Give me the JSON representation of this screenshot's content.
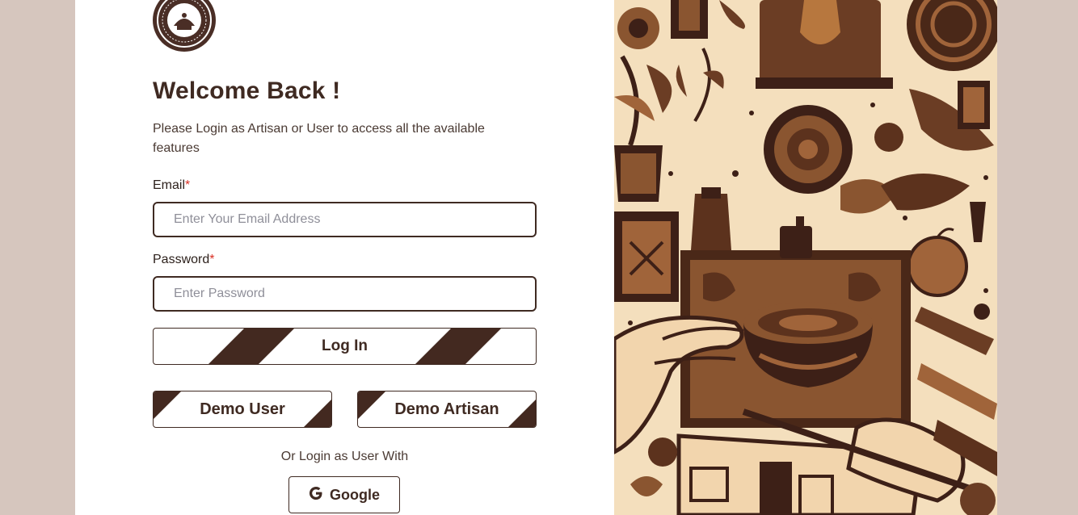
{
  "heading": {
    "title": "Welcome Back !",
    "subtitle": "Please Login as Artisan or User to access all the available features"
  },
  "form": {
    "email": {
      "label": "Email",
      "required_mark": "*",
      "placeholder": "Enter Your Email Address",
      "value": ""
    },
    "password": {
      "label": "Password",
      "required_mark": "*",
      "placeholder": "Enter Password",
      "value": ""
    },
    "login_label": "Log In"
  },
  "demo": {
    "user_label": "Demo User",
    "artisan_label": "Demo Artisan"
  },
  "social": {
    "or_text": "Or Login as User With",
    "google_label": "Google",
    "google_icon": "google-g-icon"
  },
  "brand": {
    "logo_icon": "emblem-logo-icon"
  },
  "artwork": {
    "icon": "artisan-crafts-illustration"
  },
  "colors": {
    "page_background": "#d6c6be",
    "accent_brown": "#432920",
    "text_dark": "#3f2a22",
    "required_red": "#d93025",
    "art_cream": "#f4dfbd"
  }
}
